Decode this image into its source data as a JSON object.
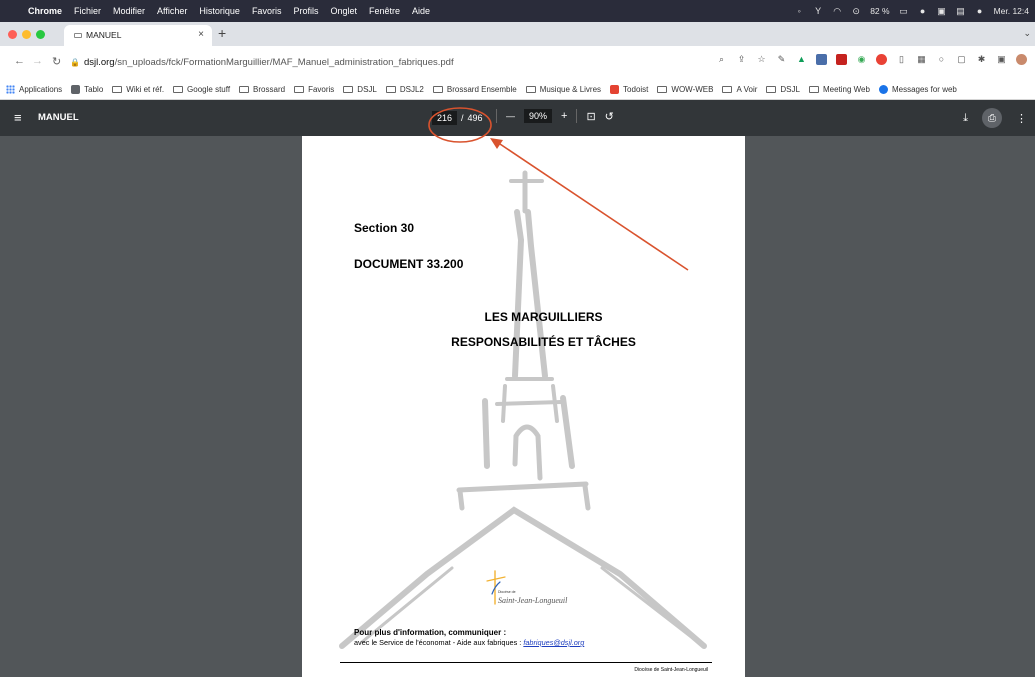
{
  "menubar": {
    "app_name": "Chrome",
    "items": [
      "Fichier",
      "Modifier",
      "Afficher",
      "Historique",
      "Favoris",
      "Profils",
      "Onglet",
      "Fenêtre",
      "Aide"
    ],
    "battery": "82 %",
    "clock": "Mer. 12:4"
  },
  "tab": {
    "title": "MANUEL",
    "close": "×",
    "new_tab": "+"
  },
  "address": {
    "host": "dsjl.org",
    "path": "/sn_uploads/fck/FormationMarguillier/MAF_Manuel_administration_fabriques.pdf"
  },
  "bookmarks": [
    {
      "label": "Applications",
      "kind": "apps"
    },
    {
      "label": "Tablo",
      "kind": "square",
      "color": "#5f6368"
    },
    {
      "label": "Wiki et réf.",
      "kind": "folder"
    },
    {
      "label": "Google stuff",
      "kind": "folder"
    },
    {
      "label": "Brossard",
      "kind": "folder"
    },
    {
      "label": "Favoris",
      "kind": "folder"
    },
    {
      "label": "DSJL",
      "kind": "folder"
    },
    {
      "label": "DSJL2",
      "kind": "folder"
    },
    {
      "label": "Brossard Ensemble",
      "kind": "folder"
    },
    {
      "label": "Musique & Livres",
      "kind": "folder"
    },
    {
      "label": "Todoist",
      "kind": "square",
      "color": "#e44332"
    },
    {
      "label": "WOW-WEB",
      "kind": "folder"
    },
    {
      "label": "A Voir",
      "kind": "folder"
    },
    {
      "label": "DSJL",
      "kind": "folder"
    },
    {
      "label": "Meeting Web",
      "kind": "folder"
    },
    {
      "label": "Messages for web",
      "kind": "circle",
      "color": "#1a73e8"
    }
  ],
  "pdf_toolbar": {
    "title": "MANUEL",
    "current_page": "216",
    "page_separator": "/",
    "total_pages": "496",
    "zoom_out": "—",
    "zoom": "90%",
    "zoom_in": "+"
  },
  "document": {
    "section": "Section 30",
    "doc_number": "DOCUMENT 33.200",
    "heading_line1": "LES MARGUILLIERS",
    "heading_line2": "RESPONSABILITÉS ET TÂCHES",
    "logo_subtitle": "Diocèse de",
    "logo_name": "Saint-Jean-Longueuil",
    "info_bold": "Pour plus d'information, communiquer :",
    "info_text": "avec le Service de l'économat - Aide aux fabriques : ",
    "info_email": "fabriques@dsjl.org",
    "footer": "Diocèse de Saint-Jean-Longueuil"
  },
  "colors": {
    "annotation": "#d9532e",
    "pdf_toolbar": "#323639",
    "viewer_bg": "#525659"
  }
}
